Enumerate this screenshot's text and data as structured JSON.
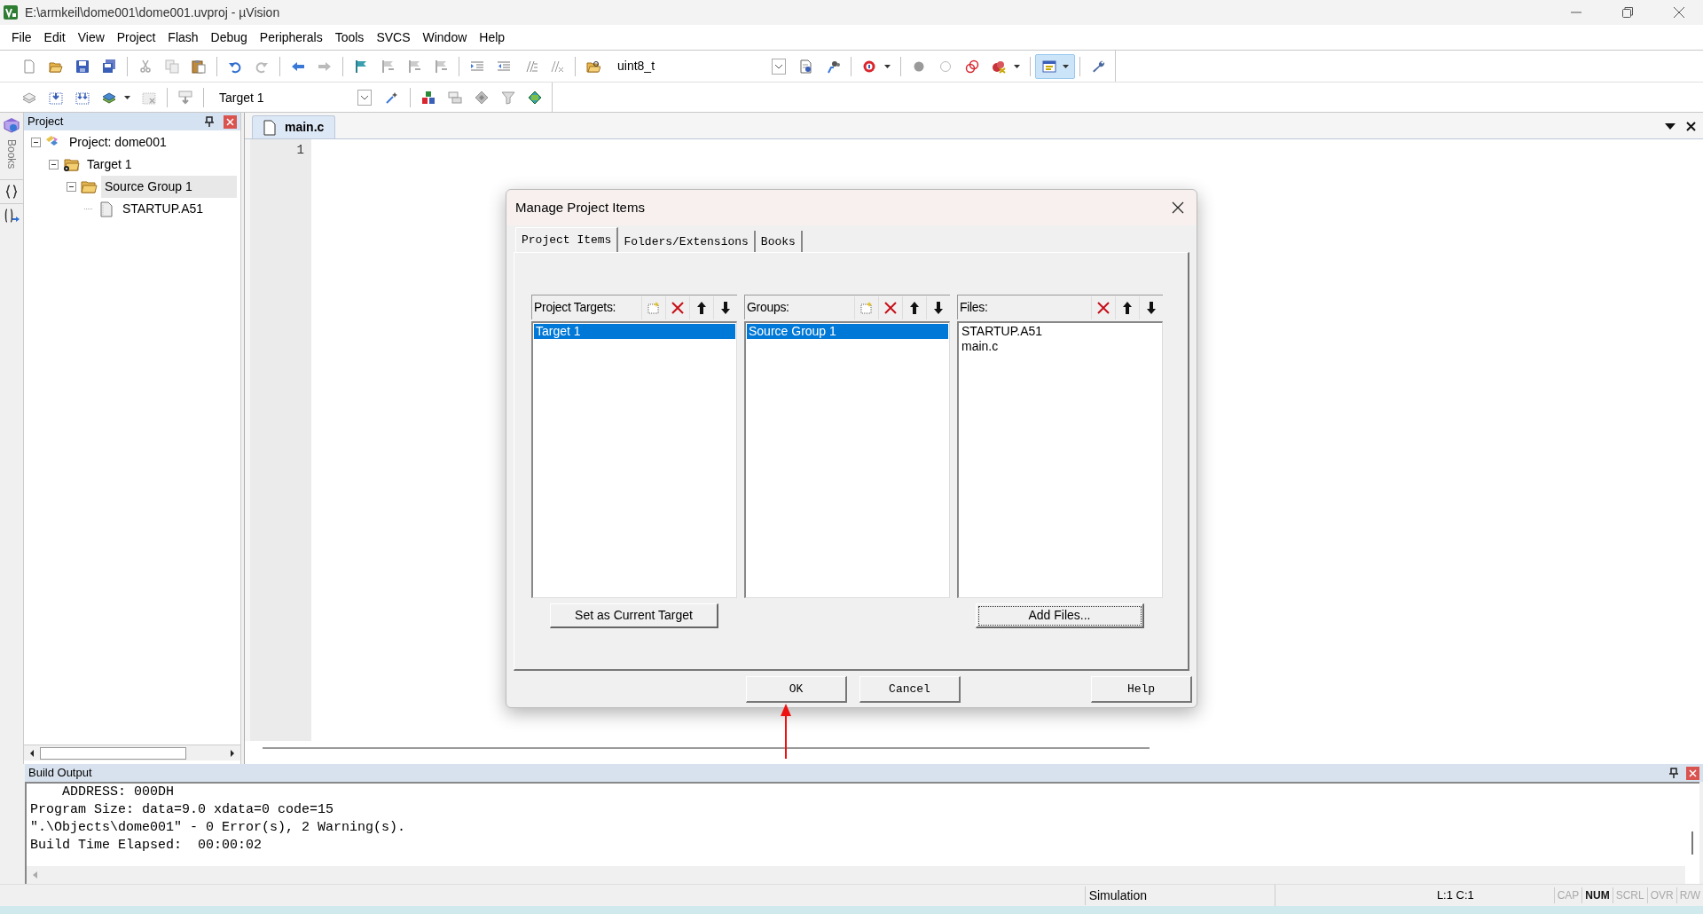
{
  "window": {
    "title": "E:\\armkeil\\dome001\\dome001.uvproj - µVision"
  },
  "menu": [
    "File",
    "Edit",
    "View",
    "Project",
    "Flash",
    "Debug",
    "Peripherals",
    "Tools",
    "SVCS",
    "Window",
    "Help"
  ],
  "toolbar": {
    "find_combo": "uint8_t"
  },
  "build_toolbar": {
    "target_combo": "Target 1"
  },
  "side_strip": {
    "books_label": "Books"
  },
  "project_panel": {
    "title": "Project",
    "tree": [
      {
        "kind": "project",
        "label": "Project: dome001",
        "expanded": true,
        "selected": false,
        "children": [
          {
            "kind": "target",
            "label": "Target 1",
            "expanded": true,
            "selected": false,
            "children": [
              {
                "kind": "group",
                "label": "Source Group 1",
                "expanded": true,
                "selected": true,
                "children": [
                  {
                    "kind": "file",
                    "label": "STARTUP.A51",
                    "selected": false
                  }
                ]
              }
            ]
          }
        ]
      }
    ]
  },
  "editor": {
    "tabs": [
      {
        "label": "main.c",
        "selected": true
      }
    ],
    "line_numbers": [
      "1"
    ]
  },
  "dialog": {
    "title": "Manage Project Items",
    "tabs": [
      {
        "label": "Project Items",
        "selected": true
      },
      {
        "label": "Folders/Extensions",
        "selected": false
      },
      {
        "label": "Books",
        "selected": false
      }
    ],
    "lists": [
      {
        "label": "Project Targets:",
        "has_new_button": true,
        "items": [
          {
            "text": "Target 1",
            "selected": true
          }
        ],
        "button": {
          "label": "Set as Current Target",
          "focused": false
        }
      },
      {
        "label": "Groups:",
        "has_new_button": true,
        "items": [
          {
            "text": "Source Group 1",
            "selected": true
          }
        ]
      },
      {
        "label": "Files:",
        "has_new_button": false,
        "items": [
          {
            "text": "STARTUP.A51",
            "selected": false
          },
          {
            "text": "main.c",
            "selected": false
          }
        ],
        "button": {
          "label": "Add Files...",
          "focused": true
        }
      }
    ],
    "footer_buttons": [
      "OK",
      "Cancel",
      "Help"
    ]
  },
  "build_output": {
    "title": "Build Output",
    "lines": [
      "    ADDRESS: 000DH",
      "Program Size: data=9.0 xdata=0 code=15",
      "\".\\Objects\\dome001\" - 0 Error(s), 2 Warning(s).",
      "Build Time Elapsed:  00:00:02"
    ]
  },
  "status_bar": {
    "mode": "Simulation",
    "position": "L:1 C:1",
    "indicators": [
      {
        "label": "CAP",
        "on": false
      },
      {
        "label": "NUM",
        "on": true
      },
      {
        "label": "SCRL",
        "on": false
      },
      {
        "label": "OVR",
        "on": false
      },
      {
        "label": "R/W",
        "on": false
      }
    ]
  }
}
